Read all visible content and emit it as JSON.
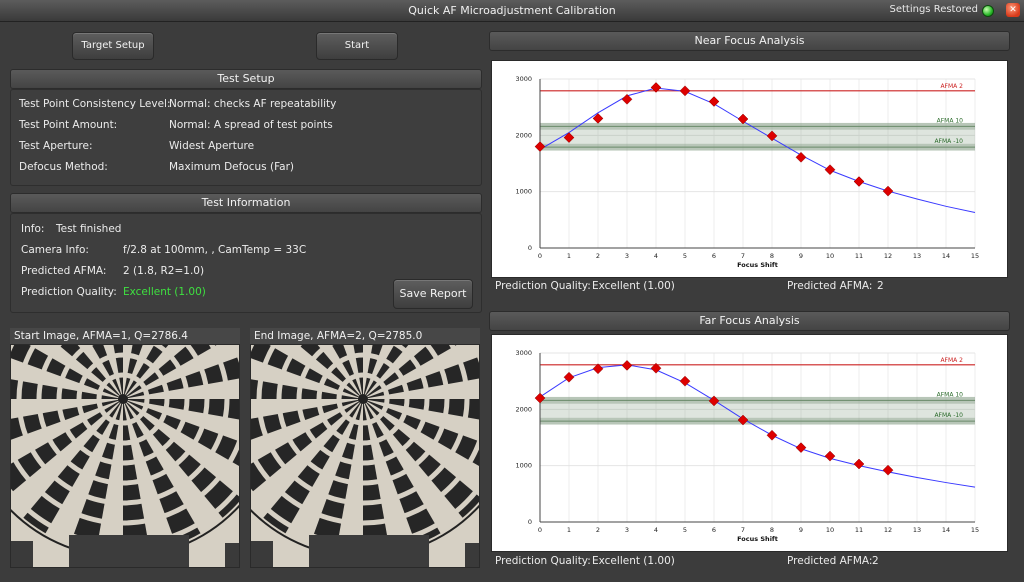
{
  "window": {
    "title": "Quick AF Microadjustment Calibration",
    "settings_status": "Settings Restored",
    "close_glyph": "✕"
  },
  "buttons": {
    "target_setup": "Target Setup",
    "start": "Start",
    "save_report": "Save Report"
  },
  "test_setup": {
    "header": "Test Setup",
    "rows": [
      {
        "label": "Test Point Consistency Level:",
        "value": "Normal: checks AF repeatability"
      },
      {
        "label": "Test Point Amount:",
        "value": "Normal: A spread of test points"
      },
      {
        "label": "Test Aperture:",
        "value": "Widest Aperture"
      },
      {
        "label": "Defocus Method:",
        "value": "Maximum Defocus (Far)"
      }
    ]
  },
  "test_info": {
    "header": "Test Information",
    "info_label": "Info:",
    "info_value": "Test finished",
    "camera_label": "Camera Info:",
    "camera_value": "f/2.8 at 100mm, , CamTemp = 33C",
    "afma_label": "Predicted AFMA:",
    "afma_value": "2 (1.8, R2=1.0)",
    "quality_label": "Prediction Quality:",
    "quality_value": "Excellent (1.00)"
  },
  "images": {
    "start_caption": "Start Image, AFMA=1, Q=2786.4",
    "end_caption": "End Image, AFMA=2, Q=2785.0"
  },
  "near_panel": {
    "header": "Near Focus Analysis",
    "quality_label": "Prediction Quality:",
    "quality_value": "Excellent (1.00)",
    "afma_label": "Predicted AFMA:",
    "afma_value": "2"
  },
  "far_panel": {
    "header": "Far Focus Analysis",
    "quality_label": "Prediction Quality:",
    "quality_value": "Excellent (1.00)",
    "afma_label": "Predicted AFMA:",
    "afma_value": "2"
  },
  "colors": {
    "points": "#dd0000",
    "curve": "#3a3aff",
    "afma_line": "#cc2222",
    "band": "#8aa08a",
    "band_text": "#2a6a2a",
    "ok_green": "#3ee040"
  },
  "chart_data": [
    {
      "type": "scatter",
      "title": "",
      "xlabel": "Focus Shift",
      "ylabel": "",
      "xlim": [
        0,
        15
      ],
      "ylim": [
        0,
        3000
      ],
      "x_ticks": [
        0,
        1,
        2,
        3,
        4,
        5,
        6,
        7,
        8,
        9,
        10,
        11,
        12,
        13,
        14,
        15
      ],
      "y_ticks": [
        0,
        1000,
        2000,
        3000
      ],
      "grid": true,
      "points": {
        "x": [
          0,
          1,
          2,
          3,
          4,
          5,
          6,
          7,
          8,
          9,
          10,
          11,
          12
        ],
        "y": [
          1800,
          1960,
          2300,
          2640,
          2850,
          2790,
          2600,
          2290,
          1990,
          1610,
          1390,
          1180,
          1010
        ]
      },
      "fit_curve": {
        "x": [
          0,
          1,
          2,
          3,
          4,
          5,
          6,
          7,
          8,
          9,
          10,
          11,
          12,
          13,
          14,
          15
        ],
        "y": [
          1750,
          2050,
          2400,
          2700,
          2840,
          2780,
          2560,
          2250,
          1950,
          1650,
          1380,
          1180,
          1010,
          870,
          740,
          630
        ]
      },
      "ref_lines": [
        {
          "label": "AFMA 2",
          "y": 2790
        },
        {
          "label": "AFMA 10",
          "y": 2160
        },
        {
          "label": "AFMA -10",
          "y": 1790
        }
      ]
    },
    {
      "type": "scatter",
      "title": "",
      "xlabel": "Focus Shift",
      "ylabel": "",
      "xlim": [
        0,
        15
      ],
      "ylim": [
        0,
        3000
      ],
      "x_ticks": [
        0,
        1,
        2,
        3,
        4,
        5,
        6,
        7,
        8,
        9,
        10,
        11,
        12,
        13,
        14,
        15
      ],
      "y_ticks": [
        0,
        1000,
        2000,
        3000
      ],
      "grid": true,
      "points": {
        "x": [
          0,
          1,
          2,
          3,
          4,
          5,
          6,
          7,
          8,
          9,
          10,
          11,
          12
        ],
        "y": [
          2200,
          2570,
          2720,
          2780,
          2730,
          2500,
          2150,
          1810,
          1540,
          1320,
          1170,
          1030,
          920
        ]
      },
      "fit_curve": {
        "x": [
          0,
          1,
          2,
          3,
          4,
          5,
          6,
          7,
          8,
          9,
          10,
          11,
          12,
          13,
          14,
          15
        ],
        "y": [
          2220,
          2560,
          2740,
          2790,
          2700,
          2470,
          2160,
          1830,
          1540,
          1300,
          1130,
          1000,
          890,
          790,
          700,
          620
        ]
      },
      "ref_lines": [
        {
          "label": "AFMA 2",
          "y": 2790
        },
        {
          "label": "AFMA 10",
          "y": 2160
        },
        {
          "label": "AFMA -10",
          "y": 1790
        }
      ]
    }
  ]
}
